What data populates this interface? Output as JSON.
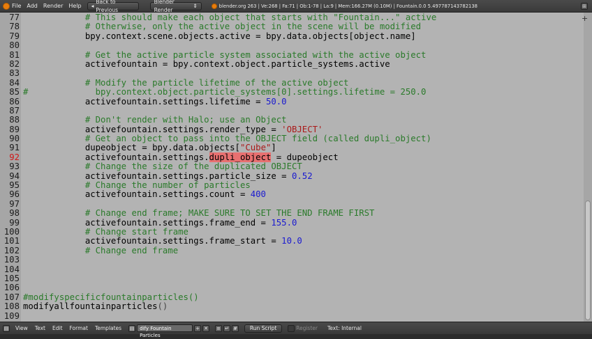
{
  "top_menu": [
    "File",
    "Add",
    "Render",
    "Help"
  ],
  "back_button": "Back to Previous",
  "render_engine": "Blender Render",
  "status_text": "blender.org 263 | Ve:268 | Fa:71 | Ob:1-78 | La:9 | Mem:166.27M (0.10M) | Fountain.0.0 5.497787143782138",
  "editor": {
    "current_line": 92,
    "lines": [
      {
        "n": 77,
        "tokens": [
          {
            "t": "            # This should make each object that starts with \"Fountain...\" active",
            "c": "c"
          }
        ]
      },
      {
        "n": 78,
        "tokens": [
          {
            "t": "            # Otherwise, only the active object in the scene will be modified",
            "c": "c"
          }
        ]
      },
      {
        "n": 79,
        "tokens": [
          {
            "t": "            bpy.context.scene.objects.active = bpy.data.objects[object.name]",
            "c": "n"
          }
        ]
      },
      {
        "n": 80,
        "tokens": []
      },
      {
        "n": 81,
        "tokens": [
          {
            "t": "            # Get the active particle system associated with the active object",
            "c": "c"
          }
        ]
      },
      {
        "n": 82,
        "tokens": [
          {
            "t": "            activefountain = bpy.context.object.particle_systems.active",
            "c": "n"
          }
        ]
      },
      {
        "n": 83,
        "tokens": []
      },
      {
        "n": 84,
        "tokens": [
          {
            "t": "            # Modify the particle lifetime of the active object",
            "c": "c"
          }
        ]
      },
      {
        "n": 85,
        "tokens": [
          {
            "t": "#             bpy.context.object.particle_systems[0].settings.lifetime = 250.0",
            "c": "c"
          }
        ]
      },
      {
        "n": 86,
        "tokens": [
          {
            "t": "            activefountain.settings.lifetime = ",
            "c": "n"
          },
          {
            "t": "50.0",
            "c": "num"
          }
        ]
      },
      {
        "n": 87,
        "tokens": []
      },
      {
        "n": 88,
        "tokens": [
          {
            "t": "            # Don't render with Halo; use an Object",
            "c": "c"
          }
        ]
      },
      {
        "n": 89,
        "tokens": [
          {
            "t": "            activefountain.settings.render_type = ",
            "c": "n"
          },
          {
            "t": "'OBJECT'",
            "c": "str"
          }
        ]
      },
      {
        "n": 90,
        "tokens": [
          {
            "t": "            # Get an object to pass into the OBJECT field (called dupli_object)",
            "c": "c"
          }
        ]
      },
      {
        "n": 91,
        "tokens": [
          {
            "t": "            dupeobject = bpy.data.objects[",
            "c": "n"
          },
          {
            "t": "\"Cube\"",
            "c": "str"
          },
          {
            "t": "]",
            "c": "n"
          }
        ]
      },
      {
        "n": 92,
        "tokens": [
          {
            "t": "            activefountain.settings.",
            "c": "n"
          },
          {
            "t": "dupli_object",
            "c": "hl"
          },
          {
            "t": " = dupeobject",
            "c": "n"
          }
        ]
      },
      {
        "n": 93,
        "tokens": [
          {
            "t": "            # Change the size of the duplicated OBJECT",
            "c": "c"
          }
        ]
      },
      {
        "n": 94,
        "tokens": [
          {
            "t": "            activefountain.settings.particle_size = ",
            "c": "n"
          },
          {
            "t": "0.52",
            "c": "num"
          }
        ]
      },
      {
        "n": 95,
        "tokens": [
          {
            "t": "            # Change the number of particles",
            "c": "c"
          }
        ]
      },
      {
        "n": 96,
        "tokens": [
          {
            "t": "            activefountain.settings.count = ",
            "c": "n"
          },
          {
            "t": "400",
            "c": "num"
          }
        ]
      },
      {
        "n": 97,
        "tokens": []
      },
      {
        "n": 98,
        "tokens": [
          {
            "t": "            # Change end frame; MAKE SURE TO SET THE END FRAME FIRST",
            "c": "c"
          }
        ]
      },
      {
        "n": 99,
        "tokens": [
          {
            "t": "            activefountain.settings.frame_end = ",
            "c": "n"
          },
          {
            "t": "155.0",
            "c": "num"
          }
        ]
      },
      {
        "n": 100,
        "tokens": [
          {
            "t": "            # Change start frame",
            "c": "c"
          }
        ]
      },
      {
        "n": 101,
        "tokens": [
          {
            "t": "            activefountain.settings.frame_start = ",
            "c": "n"
          },
          {
            "t": "10.0",
            "c": "num"
          }
        ]
      },
      {
        "n": 102,
        "tokens": [
          {
            "t": "            # Change end frame",
            "c": "c"
          }
        ]
      },
      {
        "n": 103,
        "tokens": []
      },
      {
        "n": 104,
        "tokens": []
      },
      {
        "n": 105,
        "tokens": []
      },
      {
        "n": 106,
        "tokens": []
      },
      {
        "n": 107,
        "tokens": [
          {
            "t": "#modifyspecificfountainparticles()",
            "c": "c"
          }
        ]
      },
      {
        "n": 108,
        "tokens": [
          {
            "t": "modifyallfountainparticles",
            "c": "n"
          },
          {
            "t": "()",
            "c": "op"
          }
        ]
      },
      {
        "n": 109,
        "tokens": []
      }
    ]
  },
  "bottom_menu": [
    "View",
    "Text",
    "Edit",
    "Format",
    "Templates"
  ],
  "text_name": "dify Fountain Particles",
  "run_script": "Run Script",
  "register": "Register",
  "text_location": "Text: Internal",
  "colors": {
    "editor_bg": "#b3b3b3",
    "comment": "#2a7a2a",
    "number": "#1a1ad0",
    "string": "#aa1a1a",
    "highlight": "#e87070",
    "current_line": "#d01818"
  },
  "icons": [
    "blender-logo-icon",
    "back-arrow-icon",
    "render-engine-icon",
    "plus-icon",
    "text-editor-icon",
    "screen-icon",
    "scene-icon",
    "close-icon",
    "line-numbers-icon",
    "word-wrap-icon",
    "syntax-icon",
    "python-icon"
  ]
}
